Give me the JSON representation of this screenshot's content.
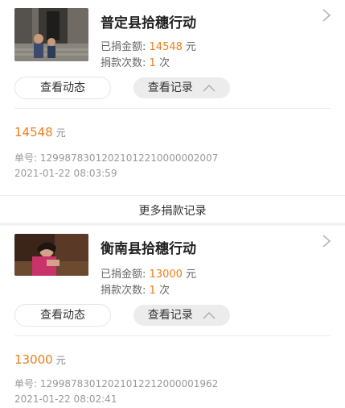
{
  "donations": [
    {
      "title": "普定县拾穗行动",
      "amount_label": "已捐金额:",
      "amount_value": "14548",
      "amount_unit": "元",
      "count_label": "捐款次数:",
      "count_value": "1",
      "count_unit": "次",
      "btn_activity": "查看动态",
      "btn_records": "查看记录",
      "record_amount": "14548",
      "record_unit": "元",
      "order_no": "单号: 12998783012021012210000002007",
      "time": "2021-01-22 08:03:59"
    },
    {
      "title": "衡南县拾穗行动",
      "amount_label": "已捐金额:",
      "amount_value": "13000",
      "amount_unit": "元",
      "count_label": "捐款次数:",
      "count_value": "1",
      "count_unit": "次",
      "btn_activity": "查看动态",
      "btn_records": "查看记录",
      "record_amount": "13000",
      "record_unit": "元",
      "order_no": "单号: 12998783012021012212000001962",
      "time": "2021-01-22 08:02:41"
    }
  ],
  "more_records": "更多捐款记录",
  "colors": {
    "accent": "#f07e1a",
    "muted": "#999999",
    "divider": "#ececec"
  }
}
